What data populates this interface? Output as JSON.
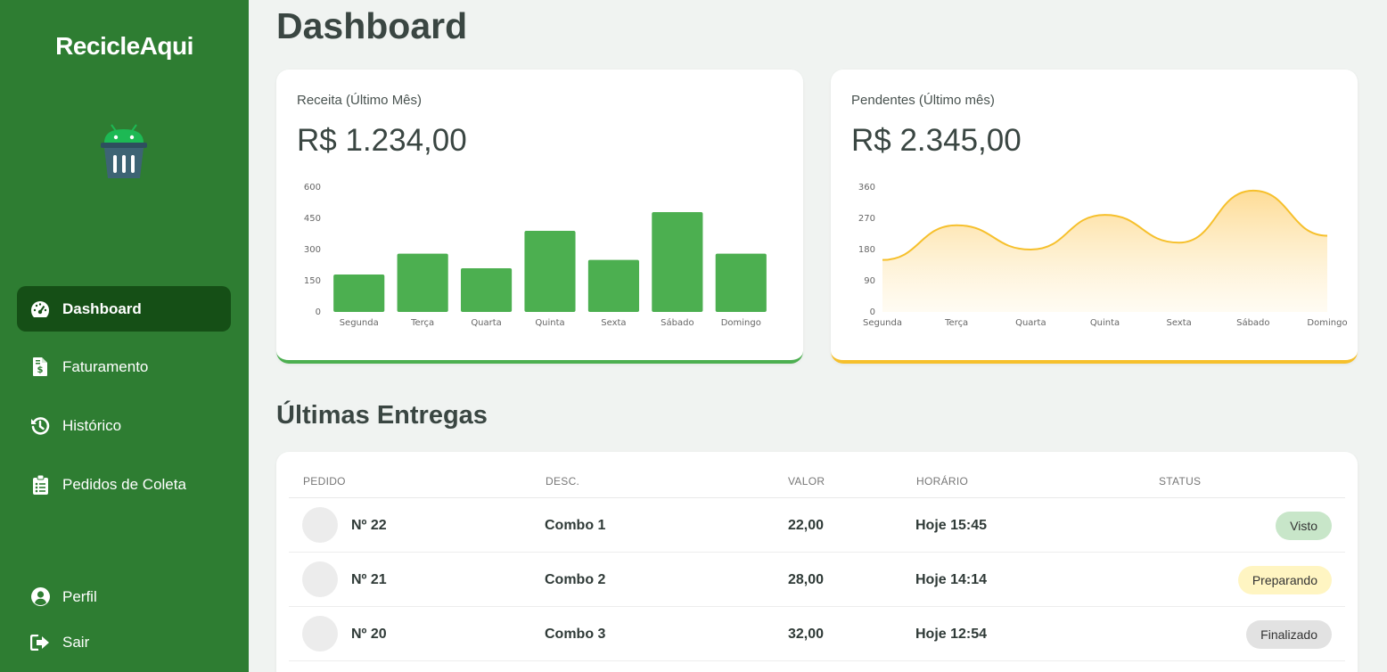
{
  "sidebar": {
    "brand": "RecicleAqui",
    "items": [
      {
        "label": "Dashboard",
        "icon": "gauge-icon",
        "active": true
      },
      {
        "label": "Faturamento",
        "icon": "invoice-dollar-icon"
      },
      {
        "label": "Histórico",
        "icon": "history-icon"
      },
      {
        "label": "Pedidos de Coleta",
        "icon": "clipboard-list-icon"
      }
    ],
    "bottom_items": [
      {
        "label": "Perfil",
        "icon": "user-circle-icon"
      },
      {
        "label": "Sair",
        "icon": "sign-out-icon"
      }
    ]
  },
  "page": {
    "title": "Dashboard"
  },
  "cards": [
    {
      "title": "Receita (Último Mês)",
      "value": "R$ 1.234,00",
      "accent": "#4caf50"
    },
    {
      "title": "Pendentes (Último mês)",
      "value": "R$ 2.345,00",
      "accent": "#f6c02c"
    }
  ],
  "chart_data": [
    {
      "type": "bar",
      "categories": [
        "Segunda",
        "Terça",
        "Quarta",
        "Quinta",
        "Sexta",
        "Sábado",
        "Domingo"
      ],
      "values": [
        180,
        280,
        210,
        390,
        250,
        480,
        280
      ],
      "ylim": [
        0,
        600
      ],
      "yticks": [
        0,
        150,
        300,
        450,
        600
      ],
      "grid": false,
      "color": "#4caf50"
    },
    {
      "type": "area",
      "categories": [
        "Segunda",
        "Terça",
        "Quarta",
        "Quinta",
        "Sexta",
        "Sábado",
        "Domingo"
      ],
      "values": [
        150,
        250,
        180,
        280,
        200,
        350,
        220
      ],
      "ylim": [
        0,
        360
      ],
      "yticks": [
        0,
        90,
        180,
        270,
        360
      ],
      "grid": false,
      "color": "#f6c02c"
    }
  ],
  "deliveries": {
    "title": "Últimas Entregas",
    "columns": [
      "PEDIDO",
      "DESC.",
      "VALOR",
      "HORÁRIO",
      "STATUS"
    ],
    "rows": [
      {
        "pedido": "Nº 22",
        "desc": "Combo 1",
        "valor": "22,00",
        "horario": "Hoje 15:45",
        "status": "Visto",
        "status_color": "#c8e6c9"
      },
      {
        "pedido": "Nº 21",
        "desc": "Combo 2",
        "valor": "28,00",
        "horario": "Hoje 14:14",
        "status": "Preparando",
        "status_color": "#fff5c2"
      },
      {
        "pedido": "Nº 20",
        "desc": "Combo 3",
        "valor": "32,00",
        "horario": "Hoje 12:54",
        "status": "Finalizado",
        "status_color": "#e2e2e2"
      }
    ]
  }
}
